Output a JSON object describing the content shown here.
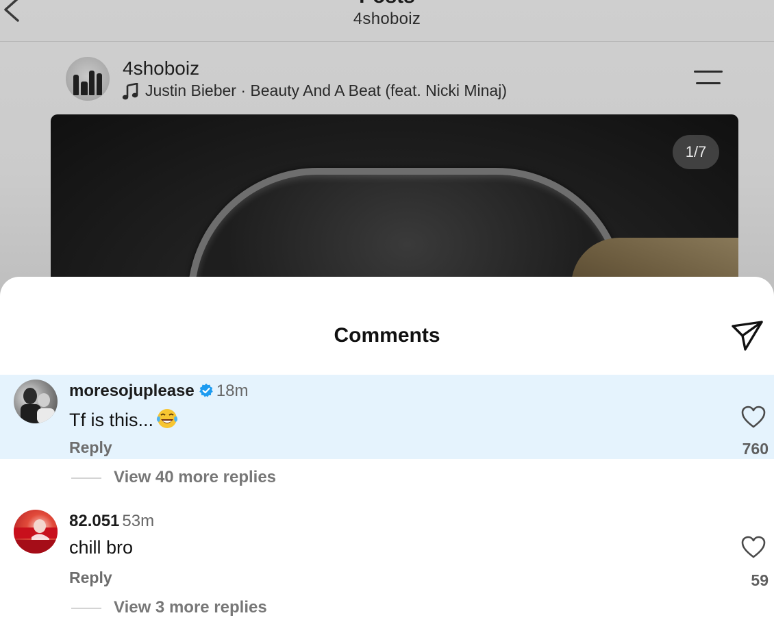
{
  "header": {
    "title": "Posts",
    "username": "4shoboiz"
  },
  "post": {
    "username": "4shoboiz",
    "music": "Justin Bieber · Beauty And A Beat (feat. Nicki Minaj)",
    "media_counter": "1/7"
  },
  "comments_sheet": {
    "title": "Comments",
    "comments": [
      {
        "username": "moresojuplease",
        "verified": true,
        "time": "18m",
        "text": "Tf is this...",
        "emoji": "face-with-tears-of-joy",
        "reply_label": "Reply",
        "likes": "760",
        "view_replies": "View 40 more replies"
      },
      {
        "username": "82.051",
        "verified": false,
        "time": "53m",
        "text": "chill bro",
        "reply_label": "Reply",
        "likes": "59",
        "view_replies": "View 3 more replies"
      }
    ]
  },
  "colors": {
    "highlight": "#e5f3fd",
    "verified_blue": "#1d9bf0"
  }
}
